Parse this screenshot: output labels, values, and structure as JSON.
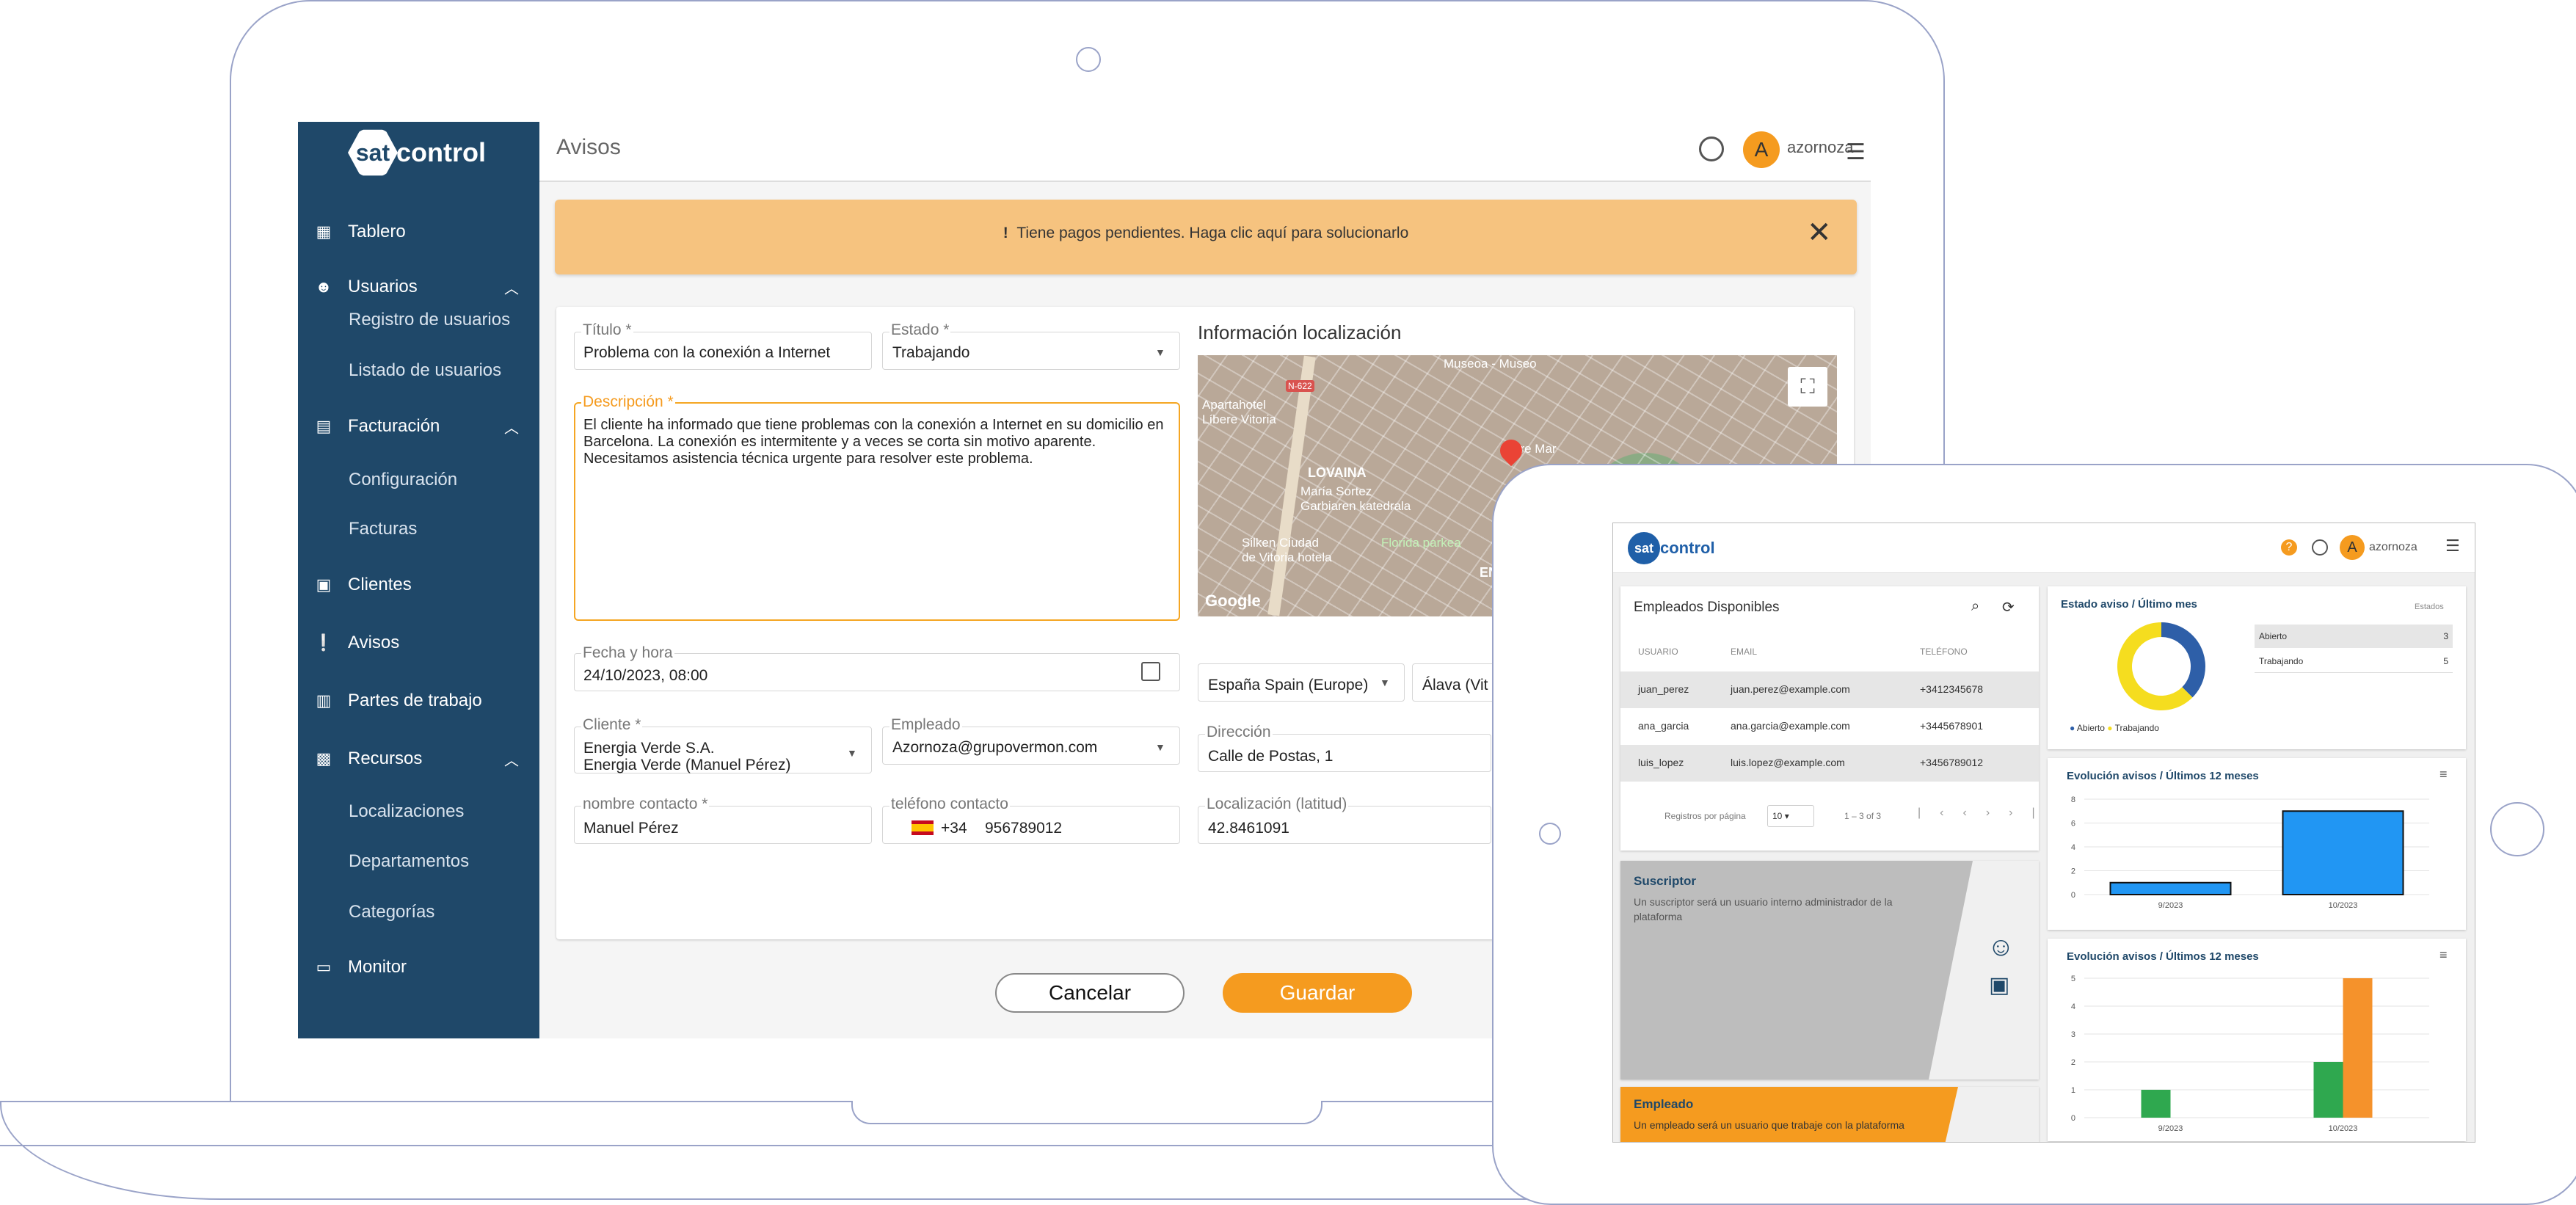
{
  "app": {
    "brand_a": "sat",
    "brand_b": "control",
    "page_title": "Avisos",
    "user": "azornoza",
    "avatar_initial": "A"
  },
  "sidebar": {
    "items": [
      {
        "label": "Tablero",
        "icon": "dashboard-icon"
      },
      {
        "label": "Usuarios",
        "icon": "face-icon"
      },
      {
        "label": "Facturación",
        "icon": "document-icon"
      },
      {
        "label": "Clientes",
        "icon": "contacts-icon"
      },
      {
        "label": "Avisos",
        "icon": "alert-icon"
      },
      {
        "label": "Partes de trabajo",
        "icon": "clipboard-icon"
      },
      {
        "label": "Recursos",
        "icon": "box-icon"
      },
      {
        "label": "Monitor",
        "icon": "monitor-icon"
      }
    ],
    "sub_usuarios": [
      "Registro de usuarios",
      "Listado de usuarios"
    ],
    "sub_facturacion": [
      "Configuración",
      "Facturas"
    ],
    "sub_recursos": [
      "Localizaciones",
      "Departamentos",
      "Categorías"
    ]
  },
  "alert": {
    "text": "Tiene pagos pendientes. Haga clic aquí para solucionarlo",
    "icon": "!",
    "close": "✕"
  },
  "form": {
    "titulo_label": "Título *",
    "titulo_value": "Problema con la conexión a Internet",
    "estado_label": "Estado *",
    "estado_value": "Trabajando",
    "descripcion_label": "Descripción *",
    "descripcion_value": "El cliente ha informado que tiene problemas con la conexión a Internet en su domicilio en Barcelona. La conexión es intermitente y a veces se corta sin motivo aparente. Necesitamos asistencia técnica urgente para resolver este problema.",
    "fecha_label": "Fecha y hora",
    "fecha_value": "24/10/2023, 08:00",
    "cliente_label": "Cliente *",
    "cliente_value_1": "Energia Verde S.A.",
    "cliente_value_2": "Energia Verde (Manuel Pérez)",
    "empleado_label": "Empleado",
    "empleado_value": "Azornoza@grupovermon.com",
    "contacto_label": "nombre contacto *",
    "contacto_value": "Manuel Pérez",
    "telefono_label": "teléfono contacto",
    "telefono_prefix": "+34",
    "telefono_value": "956789012",
    "loc_title": "Información localización",
    "pais_value": "España Spain (Europe)",
    "provincia_value": "Álava (Vit",
    "direccion_label": "Dirección",
    "direccion_value": "Calle de Postas, 1",
    "latitud_label": "Localización (latitud)",
    "latitud_value": "42.8461091",
    "cancel": "Cancelar",
    "save": "Guardar"
  },
  "map": {
    "labels": [
      "Museoa - Museo",
      "Apartahotel",
      "Líbere Vitoria",
      "dre Mar",
      "LOVAINA",
      "María Sortez",
      "Garbiaren katedrala",
      "Silken Ciudad",
      "de Vitoria hotela",
      "Florida parkea",
      "ENSANC",
      "Google",
      "N-622"
    ]
  },
  "tablet": {
    "employees": {
      "title": "Empleados Disponibles",
      "headers": [
        "USUARIO",
        "EMAIL",
        "TELÉFONO"
      ],
      "rows": [
        [
          "juan_perez",
          "juan.perez@example.com",
          "+3412345678"
        ],
        [
          "ana_garcia",
          "ana.garcia@example.com",
          "+3445678901"
        ],
        [
          "luis_lopez",
          "luis.lopez@example.com",
          "+3456789012"
        ]
      ],
      "per_page_label": "Registros por página",
      "per_page": "10",
      "range": "1 – 3 of 3"
    },
    "suscriptor": {
      "title": "Suscriptor",
      "text": "Un suscriptor será un usuario interno administrador de la plataforma"
    },
    "empleado": {
      "title": "Empleado",
      "text": "Un empleado será un usuario que trabaje con la plataforma"
    },
    "estado": {
      "title": "Estado aviso / Último mes",
      "col": "Estados",
      "rows": [
        [
          "Abierto",
          "3"
        ],
        [
          "Trabajando",
          "5"
        ]
      ],
      "legend": [
        "Abierto",
        "Trabajando"
      ]
    },
    "evo1": {
      "title": "Evolución avisos / Últimos 12 meses"
    },
    "evo2": {
      "title": "Evolución avisos / Últimos 12 meses"
    }
  },
  "chart_data": [
    {
      "type": "pie",
      "title": "Estado aviso / Último mes",
      "categories": [
        "Abierto",
        "Trabajando"
      ],
      "values": [
        3,
        5
      ],
      "colors": [
        "#2e5fa8",
        "#f5dd1f"
      ]
    },
    {
      "type": "bar",
      "title": "Evolución avisos / Últimos 12 meses",
      "categories": [
        "9/2023",
        "10/2023"
      ],
      "values": [
        1,
        7
      ],
      "ylim": [
        0,
        8
      ],
      "yticks": [
        0,
        2,
        4,
        6,
        8
      ],
      "color": "#2196f3"
    },
    {
      "type": "bar",
      "title": "Evolución avisos / Últimos 12 meses",
      "categories": [
        "9/2023",
        "10/2023"
      ],
      "series": [
        {
          "values": [
            1,
            2
          ],
          "color": "#2fa84f"
        },
        {
          "values": [
            0,
            5
          ],
          "color": "#f5922b"
        }
      ],
      "ylim": [
        0,
        5
      ],
      "yticks": [
        0,
        1,
        2,
        3,
        4,
        5
      ]
    }
  ]
}
